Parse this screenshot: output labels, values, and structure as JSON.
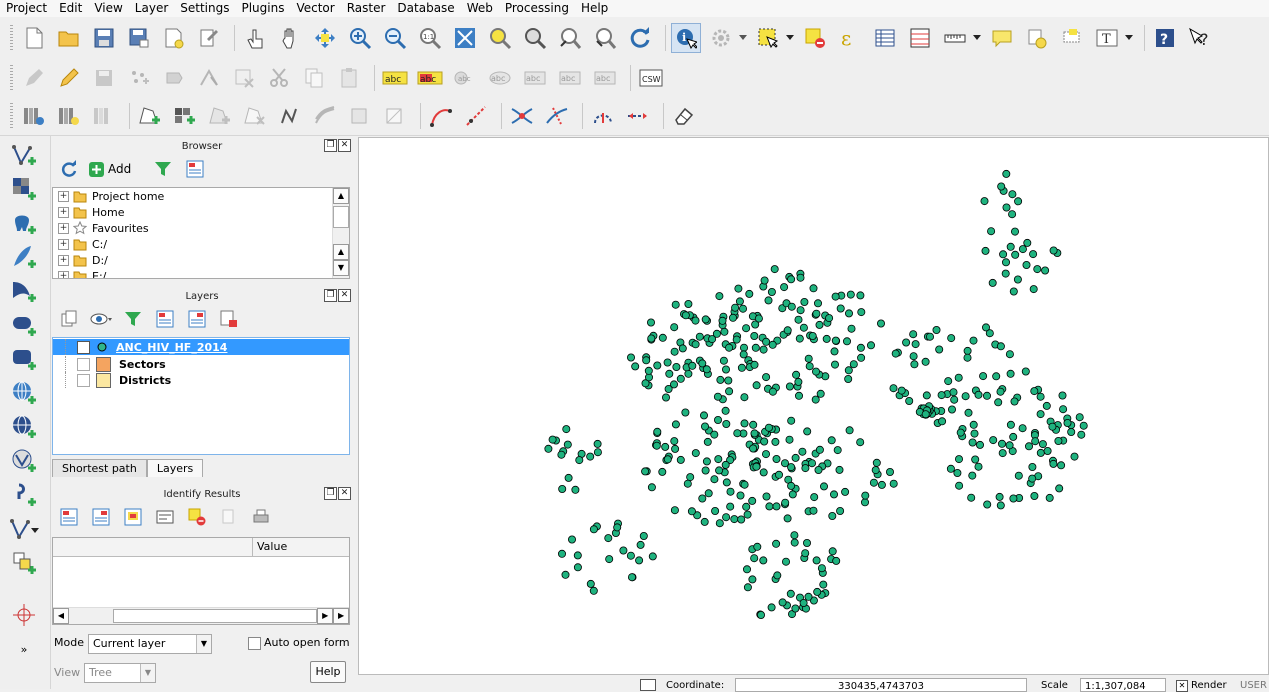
{
  "menu": [
    "Project",
    "Edit",
    "View",
    "Layer",
    "Settings",
    "Plugins",
    "Vector",
    "Raster",
    "Database",
    "Web",
    "Processing",
    "Help"
  ],
  "toolbar": {
    "csw_label": "CSW",
    "abc_label": "abc"
  },
  "browser": {
    "title": "Browser",
    "add_label": "Add",
    "items": [
      "Project home",
      "Home",
      "Favourites",
      "C:/",
      "D:/",
      "E:/"
    ]
  },
  "layers": {
    "title": "Layers",
    "items": [
      {
        "name": "ANC_HIV_HF_2014",
        "checked": "✕",
        "color": "#2fb58a"
      },
      {
        "name": "Sectors",
        "checked": "",
        "color": "#f4a460"
      },
      {
        "name": "Districts",
        "checked": "",
        "color": "#fbe7a1"
      }
    ],
    "tabs": [
      "Shortest path",
      "Layers"
    ]
  },
  "identify": {
    "title": "Identify Results",
    "col_feature": "",
    "col_value": "Value",
    "mode_label": "Mode",
    "mode_value": "Current layer",
    "auto_open": "Auto open form",
    "view_label": "View",
    "view_value": "Tree",
    "help_label": "Help"
  },
  "status": {
    "coordinate_label": "Coordinate:",
    "coordinate_value": "330435,4743703",
    "scale_label": "Scale",
    "scale_value": "1:1,307,084",
    "render_label": "Render",
    "user_label": "USER"
  },
  "colors": {
    "point_fill": "#1fb37f",
    "selection": "#3399ff"
  },
  "map_seed": 20140
}
